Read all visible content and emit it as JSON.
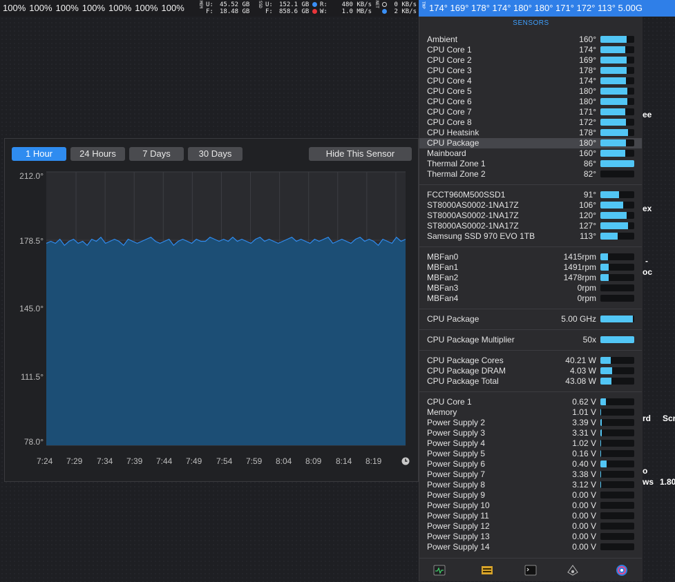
{
  "menubar": {
    "cpu_percents": [
      "100%",
      "100%",
      "100%",
      "100%",
      "100%",
      "100%",
      "100%"
    ],
    "mem_tag": "MEM",
    "mem_used_label": "U:",
    "mem_used": "45.52 GB",
    "mem_free_label": "F:",
    "mem_free": "18.48 GB",
    "ssd_tag": "SSD",
    "ssd_used_label": "U:",
    "ssd_used": "152.1 GB",
    "ssd_free_label": "F:",
    "ssd_free": "858.6 GB",
    "disk_read_label": "R:",
    "disk_read": "480 KB/s",
    "disk_write_label": "W:",
    "disk_write": "1.0 MB/s",
    "net_tag": "NET",
    "net_up": "0 KB/s",
    "net_down": "2 KB/s",
    "tmp_tag": "TMP",
    "temps_text": "174° 169° 178° 174° 180° 180° 171° 172° 113° 5.00G"
  },
  "desktop_labels": [
    "ee",
    "ex",
    "-",
    "oc",
    "rd",
    "Scr",
    "o",
    "ws",
    "1.80"
  ],
  "graph": {
    "range_buttons": [
      "1 Hour",
      "24 Hours",
      "7 Days",
      "30 Days"
    ],
    "hide_button": "Hide This Sensor",
    "clock_icon": "clock-icon"
  },
  "chart_data": {
    "type": "area",
    "title": "",
    "xlabel": "",
    "ylabel": "",
    "y_ticks": [
      "212.0°",
      "178.5°",
      "145.0°",
      "111.5°",
      "78.0°"
    ],
    "ylim": [
      78.0,
      212.0
    ],
    "x_ticks": [
      "7:24",
      "7:29",
      "7:34",
      "7:39",
      "7:44",
      "7:49",
      "7:54",
      "7:59",
      "8:04",
      "8:09",
      "8:14",
      "8:19"
    ],
    "grid": true,
    "series": [
      {
        "color": "#2f8cf0",
        "values": [
          177,
          178,
          177,
          179,
          176,
          178,
          179,
          177,
          178,
          176,
          179,
          178,
          180,
          177,
          178,
          179,
          178,
          176,
          179,
          178,
          177,
          178,
          179,
          180,
          178,
          177,
          178,
          179,
          176,
          178,
          179,
          178,
          177,
          179,
          178,
          178,
          180,
          179,
          178,
          179,
          178,
          180,
          178,
          179,
          178,
          177,
          179,
          180,
          178,
          179,
          178,
          177,
          178,
          179,
          180,
          178,
          179,
          178,
          177,
          179,
          178,
          179,
          180,
          177,
          178,
          179,
          178,
          177,
          179,
          180,
          178,
          179,
          178,
          176,
          179,
          178,
          177,
          180,
          178,
          179
        ]
      }
    ]
  },
  "sensors": {
    "title": "SENSORS",
    "groups": [
      [
        {
          "label": "Ambient",
          "value": "160°",
          "pct": 0.78
        },
        {
          "label": "CPU Core 1",
          "value": "174°",
          "pct": 0.74
        },
        {
          "label": "CPU Core 2",
          "value": "169°",
          "pct": 0.78
        },
        {
          "label": "CPU Core 3",
          "value": "178°",
          "pct": 0.78
        },
        {
          "label": "CPU Core 4",
          "value": "174°",
          "pct": 0.76
        },
        {
          "label": "CPU Core 5",
          "value": "180°",
          "pct": 0.8
        },
        {
          "label": "CPU Core 6",
          "value": "180°",
          "pct": 0.8
        },
        {
          "label": "CPU Core 7",
          "value": "171°",
          "pct": 0.74
        },
        {
          "label": "CPU Core 8",
          "value": "172°",
          "pct": 0.76
        },
        {
          "label": "CPU Heatsink",
          "value": "178°",
          "pct": 0.82
        },
        {
          "label": "CPU Package",
          "value": "180°",
          "pct": 0.76,
          "highlight": true
        },
        {
          "label": "Mainboard",
          "value": "160°",
          "pct": 0.74
        },
        {
          "label": "Thermal Zone 1",
          "value": "86°",
          "pct": 1.0
        },
        {
          "label": "Thermal Zone 2",
          "value": "82°",
          "pct": 0.0
        }
      ],
      [
        {
          "label": "FCCT960M500SSD1",
          "value": "91°",
          "pct": 0.56
        },
        {
          "label": "ST8000AS0002-1NA17Z",
          "value": "106°",
          "pct": 0.68
        },
        {
          "label": "ST8000AS0002-1NA17Z",
          "value": "120°",
          "pct": 0.78
        },
        {
          "label": "ST8000AS0002-1NA17Z",
          "value": "127°",
          "pct": 0.82
        },
        {
          "label": "Samsung SSD 970 EVO 1TB",
          "value": "113°",
          "pct": 0.52
        }
      ],
      [
        {
          "label": "MBFan0",
          "value": "1415rpm",
          "pct": 0.22
        },
        {
          "label": "MBFan1",
          "value": "1491rpm",
          "pct": 0.24
        },
        {
          "label": "MBFan2",
          "value": "1478rpm",
          "pct": 0.24
        },
        {
          "label": "MBFan3",
          "value": "0rpm",
          "pct": 0.0
        },
        {
          "label": "MBFan4",
          "value": "0rpm",
          "pct": 0.0
        }
      ],
      [
        {
          "label": "CPU Package",
          "value": "5.00 GHz",
          "pct": 0.96
        }
      ],
      [
        {
          "label": "CPU Package Multiplier",
          "value": "50x",
          "pct": 1.0
        }
      ],
      [
        {
          "label": "CPU Package Cores",
          "value": "40.21 W",
          "pct": 0.3
        },
        {
          "label": "CPU Package DRAM",
          "value": "4.03 W",
          "pct": 0.34
        },
        {
          "label": "CPU Package Total",
          "value": "43.08 W",
          "pct": 0.32
        }
      ],
      [
        {
          "label": "CPU Core 1",
          "value": "0.62 V",
          "pct": 0.16
        },
        {
          "label": "Memory",
          "value": "1.01 V",
          "pct": 0.02
        },
        {
          "label": "Power Supply 2",
          "value": "3.39 V",
          "pct": 0.04
        },
        {
          "label": "Power Supply 3",
          "value": "3.31 V",
          "pct": 0.04
        },
        {
          "label": "Power Supply 4",
          "value": "1.02 V",
          "pct": 0.02
        },
        {
          "label": "Power Supply 5",
          "value": "0.16 V",
          "pct": 0.02
        },
        {
          "label": "Power Supply 6",
          "value": "0.40 V",
          "pct": 0.18
        },
        {
          "label": "Power Supply 7",
          "value": "3.38 V",
          "pct": 0.02
        },
        {
          "label": "Power Supply 8",
          "value": "3.12 V",
          "pct": 0.02
        },
        {
          "label": "Power Supply 9",
          "value": "0.00 V",
          "pct": 0.0
        },
        {
          "label": "Power Supply 10",
          "value": "0.00 V",
          "pct": 0.0
        },
        {
          "label": "Power Supply 11",
          "value": "0.00 V",
          "pct": 0.0
        },
        {
          "label": "Power Supply 12",
          "value": "0.00 V",
          "pct": 0.0
        },
        {
          "label": "Power Supply 13",
          "value": "0.00 V",
          "pct": 0.0
        },
        {
          "label": "Power Supply 14",
          "value": "0.00 V",
          "pct": 0.0
        }
      ]
    ],
    "footer_icons": [
      "activity-monitor-icon",
      "gpu-monitor-icon",
      "terminal-icon",
      "disk-utility-icon",
      "istat-icon"
    ]
  }
}
